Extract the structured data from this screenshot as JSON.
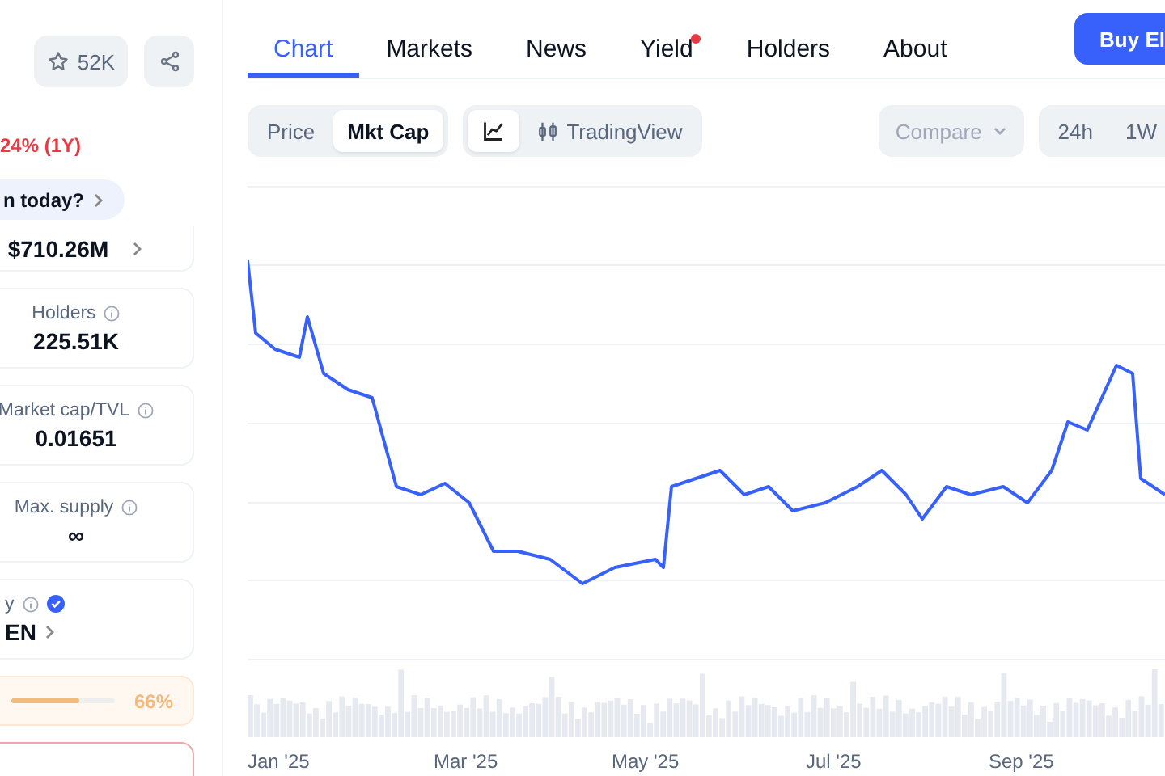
{
  "header": {
    "watchlist_count": "52K"
  },
  "change": "24% (1Y)",
  "prompt": "n today?",
  "stats": [
    {
      "kind": "value",
      "value": "$710.26M"
    },
    {
      "kind": "stat",
      "label": "Holders",
      "value": "225.51K"
    },
    {
      "kind": "stat",
      "label": "Market cap/TVL",
      "value": "0.01651"
    },
    {
      "kind": "stat",
      "label": "Max. supply",
      "value": "∞"
    },
    {
      "kind": "verified",
      "label": "y",
      "value": "EN"
    },
    {
      "kind": "progress",
      "level": 0.66,
      "reading": "66%"
    }
  ],
  "tabs": [
    {
      "label": "Chart",
      "selected": true,
      "dot": false
    },
    {
      "label": "Markets",
      "selected": false,
      "dot": false
    },
    {
      "label": "News",
      "selected": false,
      "dot": false
    },
    {
      "label": "Yield",
      "selected": false,
      "dot": true
    },
    {
      "label": "Holders",
      "selected": false,
      "dot": false
    },
    {
      "label": "About",
      "selected": false,
      "dot": false
    }
  ],
  "buy_button": "Buy El",
  "metric_toggle": [
    {
      "label": "Price",
      "selected": false
    },
    {
      "label": "Mkt Cap",
      "selected": true
    }
  ],
  "chart_type": [
    {
      "kind": "line",
      "selected": true
    },
    {
      "kind": "tradingview",
      "label": "TradingView",
      "selected": false
    }
  ],
  "compare": {
    "placeholder": "Compare"
  },
  "ranges": [
    {
      "label": "24h",
      "selected": false
    },
    {
      "label": "1W",
      "selected": false
    }
  ],
  "chart": {
    "x_labels": [
      "Jan '25",
      "Mar '25",
      "May '25",
      "Jul '25",
      "Sep '25"
    ]
  }
}
